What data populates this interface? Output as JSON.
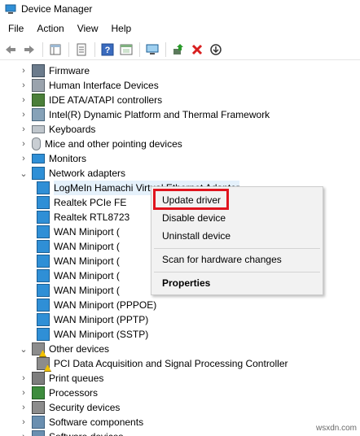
{
  "window": {
    "title": "Device Manager"
  },
  "menu": [
    "File",
    "Action",
    "View",
    "Help"
  ],
  "toolbar_icons": [
    "back-arrow-icon",
    "forward-arrow-icon",
    "show-hide-console-icon",
    "properties-icon",
    "help-icon",
    "console-tree-icon",
    "scan-hardware-icon",
    "update-driver-icon",
    "uninstall-icon",
    "disable-icon"
  ],
  "tree": [
    {
      "label": "Firmware",
      "expanded": false
    },
    {
      "label": "Human Interface Devices",
      "expanded": false
    },
    {
      "label": "IDE ATA/ATAPI controllers",
      "expanded": false
    },
    {
      "label": "Intel(R) Dynamic Platform and Thermal Framework",
      "expanded": false
    },
    {
      "label": "Keyboards",
      "expanded": false
    },
    {
      "label": "Mice and other pointing devices",
      "expanded": false
    },
    {
      "label": "Monitors",
      "expanded": false
    },
    {
      "label": "Network adapters",
      "expanded": true
    },
    {
      "label": "LogMeIn Hamachi Virtual Ethernet Adapter",
      "child": true
    },
    {
      "label": "Realtek PCIe FE",
      "child": true
    },
    {
      "label": "Realtek RTL8723",
      "child": true
    },
    {
      "label": "WAN Miniport (",
      "child": true
    },
    {
      "label": "WAN Miniport (",
      "child": true
    },
    {
      "label": "WAN Miniport (",
      "child": true
    },
    {
      "label": "WAN Miniport (",
      "child": true
    },
    {
      "label": "WAN Miniport (",
      "child": true
    },
    {
      "label": "WAN Miniport (PPPOE)",
      "child": true
    },
    {
      "label": "WAN Miniport (PPTP)",
      "child": true
    },
    {
      "label": "WAN Miniport (SSTP)",
      "child": true
    },
    {
      "label": "Other devices",
      "expanded": true
    },
    {
      "label": "PCI Data Acquisition and Signal Processing Controller",
      "child": true
    },
    {
      "label": "Print queues",
      "expanded": false
    },
    {
      "label": "Processors",
      "expanded": false
    },
    {
      "label": "Security devices",
      "expanded": false
    },
    {
      "label": "Software components",
      "expanded": false
    },
    {
      "label": "Software devices",
      "expanded": false
    }
  ],
  "context_menu": {
    "update_driver": "Update driver",
    "disable_device": "Disable device",
    "uninstall_device": "Uninstall device",
    "scan": "Scan for hardware changes",
    "properties": "Properties"
  },
  "watermark": "wsxdn.com",
  "colors": {
    "highlight": "#e0141e",
    "selection": "#e5f1fb",
    "menu_bg": "#f2f2f2"
  }
}
